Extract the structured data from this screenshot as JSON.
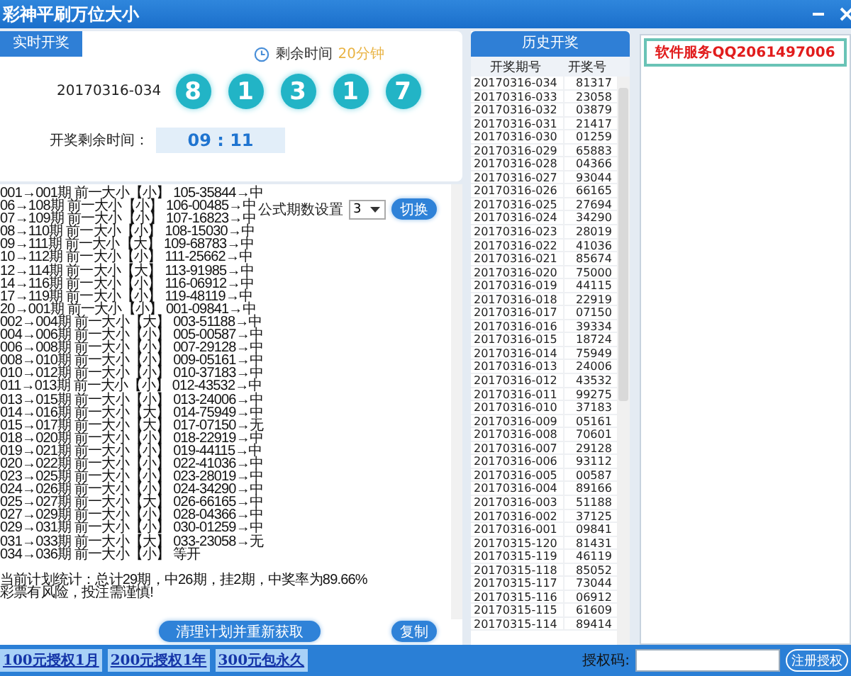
{
  "window": {
    "title": "彩神平刷万位大小"
  },
  "live": {
    "tab": "实时开奖",
    "remaining_label": "剩余时间",
    "remaining_value": "20分钟",
    "period": "20170316-034",
    "balls": [
      "8",
      "1",
      "3",
      "1",
      "7"
    ],
    "countdown_label": "开奖剩余时间：",
    "countdown": "09 : 11"
  },
  "plan": {
    "setting_label": "公式期数设置",
    "setting_value": "3",
    "switch_button": "切换",
    "lines": [
      "001→001期 前一大小【小】 105-35844→中",
      "06→108期 前一大小【小】 106-00485→中",
      "07→109期 前一大小【小】 107-16823→中",
      "08→110期 前一大小【小】 108-15030→中",
      "09→111期 前一大小【大】 109-68783→中",
      "10→112期 前一大小【小】 111-25662→中",
      "12→114期 前一大小【大】 113-91985→中",
      "14→116期 前一大小【小】 116-06912→中",
      "17→119期 前一大小【小】 119-48119→中",
      "20→001期 前一大小【小】 001-09841→中",
      "002→004期 前一大小【大】 003-51188→中",
      "004→006期 前一大小【小】 005-00587→中",
      "006→008期 前一大小【小】 007-29128→中",
      "008→010期 前一大小【小】 009-05161→中",
      "010→012期 前一大小【小】 010-37183→中",
      "011→013期 前一大小【小】 012-43532→中",
      "013→015期 前一大小【小】 013-24006→中",
      "014→016期 前一大小【大】 014-75949→中",
      "015→017期 前一大小【大】 017-07150→无",
      "018→020期 前一大小【小】 018-22919→中",
      "019→021期 前一大小【小】 019-44115→中",
      "020→022期 前一大小【小】 022-41036→中",
      "023→025期 前一大小【小】 023-28019→中",
      "024→026期 前一大小【小】 024-34290→中",
      "025→027期 前一大小【大】 026-66165→中",
      "027→029期 前一大小【小】 028-04366→中",
      "029→031期 前一大小【小】 030-01259→中",
      "031→033期 前一大小【大】 033-23058→无",
      "034→036期 前一大小【小】 等开"
    ],
    "summary": [
      "当前计划统计：总计29期，中26期，挂2期，中奖率为89.66%",
      "彩票有风险，投注需谨慎!"
    ],
    "refresh_button": "清理计划并重新获取",
    "copy_button": "复制"
  },
  "history": {
    "title": "历史开奖",
    "columns": [
      "开奖期号",
      "开奖号"
    ],
    "rows": [
      [
        "20170316-034",
        "81317"
      ],
      [
        "20170316-033",
        "23058"
      ],
      [
        "20170316-032",
        "03879"
      ],
      [
        "20170316-031",
        "21417"
      ],
      [
        "20170316-030",
        "01259"
      ],
      [
        "20170316-029",
        "65883"
      ],
      [
        "20170316-028",
        "04366"
      ],
      [
        "20170316-027",
        "93044"
      ],
      [
        "20170316-026",
        "66165"
      ],
      [
        "20170316-025",
        "27694"
      ],
      [
        "20170316-024",
        "34290"
      ],
      [
        "20170316-023",
        "28019"
      ],
      [
        "20170316-022",
        "41036"
      ],
      [
        "20170316-021",
        "85674"
      ],
      [
        "20170316-020",
        "75000"
      ],
      [
        "20170316-019",
        "44115"
      ],
      [
        "20170316-018",
        "22919"
      ],
      [
        "20170316-017",
        "07150"
      ],
      [
        "20170316-016",
        "39334"
      ],
      [
        "20170316-015",
        "18724"
      ],
      [
        "20170316-014",
        "75949"
      ],
      [
        "20170316-013",
        "24006"
      ],
      [
        "20170316-012",
        "43532"
      ],
      [
        "20170316-011",
        "99275"
      ],
      [
        "20170316-010",
        "37183"
      ],
      [
        "20170316-009",
        "05161"
      ],
      [
        "20170316-008",
        "70601"
      ],
      [
        "20170316-007",
        "29128"
      ],
      [
        "20170316-006",
        "93112"
      ],
      [
        "20170316-005",
        "00587"
      ],
      [
        "20170316-004",
        "89166"
      ],
      [
        "20170316-003",
        "51188"
      ],
      [
        "20170316-002",
        "37125"
      ],
      [
        "20170316-001",
        "09841"
      ],
      [
        "20170315-120",
        "81431"
      ],
      [
        "20170315-119",
        "46119"
      ],
      [
        "20170315-118",
        "85052"
      ],
      [
        "20170315-117",
        "73044"
      ],
      [
        "20170315-116",
        "06912"
      ],
      [
        "20170315-115",
        "61609"
      ],
      [
        "20170315-114",
        "89414"
      ]
    ]
  },
  "service": {
    "title": "软件服务QQ2061497006"
  },
  "footer": {
    "plans": [
      "100元授权1月",
      "200元授权1年",
      "300元包永久"
    ],
    "code_label": "授权码:",
    "register_button": "注册授权"
  }
}
